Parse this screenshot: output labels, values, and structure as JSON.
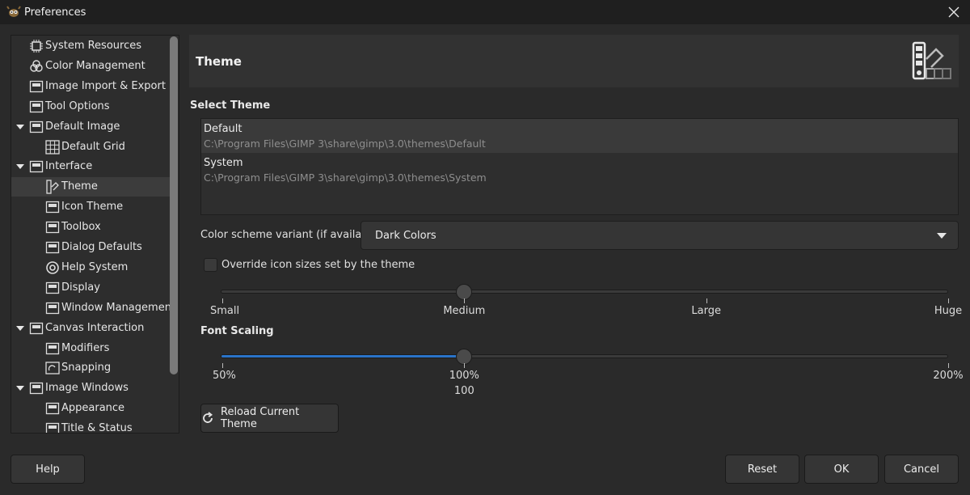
{
  "window": {
    "title": "Preferences"
  },
  "sidebar": {
    "items": [
      {
        "label": "System Resources",
        "icon": "chip-icon",
        "indent": 1,
        "expander": false,
        "selected": false
      },
      {
        "label": "Color Management",
        "icon": "color-circles-icon",
        "indent": 1,
        "expander": false,
        "selected": false
      },
      {
        "label": "Image Import & Export",
        "icon": "image-import-icon",
        "indent": 1,
        "expander": false,
        "selected": false
      },
      {
        "label": "Tool Options",
        "icon": "tool-options-icon",
        "indent": 1,
        "expander": false,
        "selected": false
      },
      {
        "label": "Default Image",
        "icon": "default-image-icon",
        "indent": 1,
        "expander": true,
        "selected": false
      },
      {
        "label": "Default Grid",
        "icon": "grid-icon",
        "indent": 2,
        "expander": false,
        "selected": false
      },
      {
        "label": "Interface",
        "icon": "interface-icon",
        "indent": 1,
        "expander": true,
        "selected": false
      },
      {
        "label": "Theme",
        "icon": "theme-icon",
        "indent": 2,
        "expander": false,
        "selected": true
      },
      {
        "label": "Icon Theme",
        "icon": "icon-theme-icon",
        "indent": 2,
        "expander": false,
        "selected": false
      },
      {
        "label": "Toolbox",
        "icon": "toolbox-icon",
        "indent": 2,
        "expander": false,
        "selected": false
      },
      {
        "label": "Dialog Defaults",
        "icon": "dialog-defaults-icon",
        "indent": 2,
        "expander": false,
        "selected": false
      },
      {
        "label": "Help System",
        "icon": "help-icon",
        "indent": 2,
        "expander": false,
        "selected": false
      },
      {
        "label": "Display",
        "icon": "display-icon",
        "indent": 2,
        "expander": false,
        "selected": false
      },
      {
        "label": "Window Management",
        "icon": "window-management-icon",
        "indent": 2,
        "expander": false,
        "selected": false
      },
      {
        "label": "Canvas Interaction",
        "icon": "canvas-icon",
        "indent": 1,
        "expander": true,
        "selected": false
      },
      {
        "label": "Modifiers",
        "icon": "modifiers-icon",
        "indent": 2,
        "expander": false,
        "selected": false
      },
      {
        "label": "Snapping",
        "icon": "snapping-icon",
        "indent": 2,
        "expander": false,
        "selected": false
      },
      {
        "label": "Image Windows",
        "icon": "image-windows-icon",
        "indent": 1,
        "expander": true,
        "selected": false
      },
      {
        "label": "Appearance",
        "icon": "appearance-icon",
        "indent": 2,
        "expander": false,
        "selected": false
      },
      {
        "label": "Title & Status",
        "icon": "title-status-icon",
        "indent": 2,
        "expander": false,
        "selected": false
      }
    ]
  },
  "header": {
    "title": "Theme",
    "icon": "theme-swatch-icon"
  },
  "select_theme": {
    "label": "Select Theme",
    "themes": [
      {
        "name": "Default",
        "path": "C:\\Program Files\\GIMP 3\\share\\gimp\\3.0\\themes\\Default",
        "selected": true
      },
      {
        "name": "System",
        "path": "C:\\Program Files\\GIMP 3\\share\\gimp\\3.0\\themes\\System",
        "selected": false
      }
    ]
  },
  "color_scheme": {
    "label": "Color scheme variant (if available)",
    "value": "Dark Colors"
  },
  "override_icons": {
    "label": "Override icon sizes set by the theme",
    "checked": false
  },
  "icon_size": {
    "ticks": [
      "Small",
      "Medium",
      "Large",
      "Huge"
    ],
    "value_index": 1
  },
  "font_scaling": {
    "label": "Font Scaling",
    "ticks": [
      "50%",
      "100%",
      "200%"
    ],
    "min": 50,
    "max": 200,
    "value": 100,
    "value_display": "100"
  },
  "reload_button": {
    "label": "Reload Current Theme",
    "icon": "refresh-icon"
  },
  "footer": {
    "help": "Help",
    "reset": "Reset",
    "ok": "OK",
    "cancel": "Cancel"
  },
  "colors": {
    "accent": "#2a73c8",
    "background": "#2a2a2a",
    "titlebar": "#1f1f1f"
  }
}
